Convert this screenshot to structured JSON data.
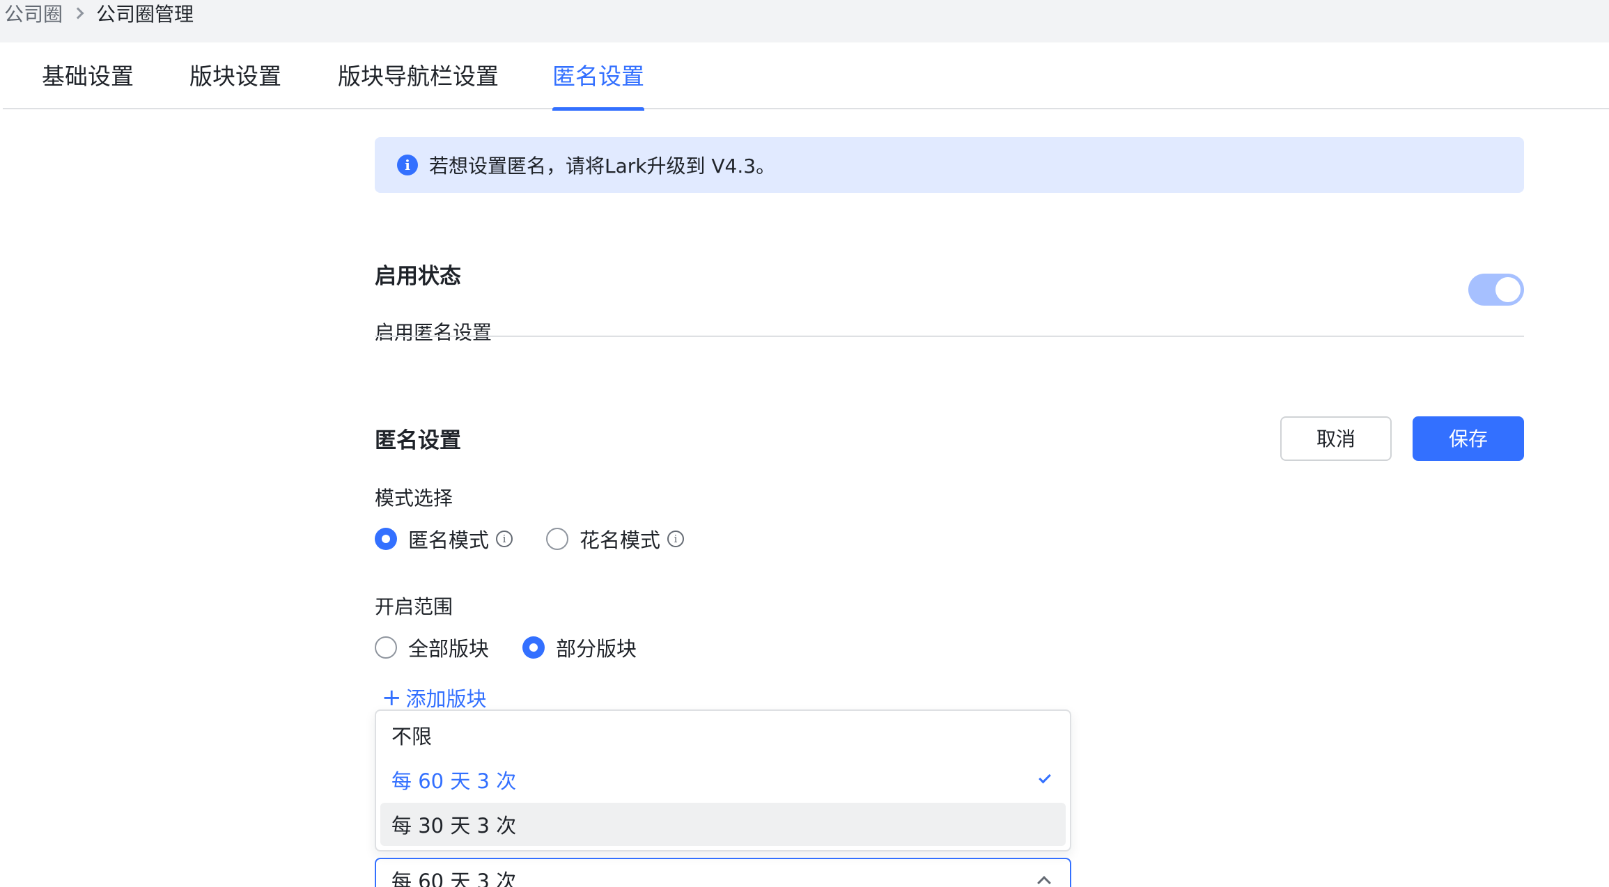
{
  "breadcrumb": {
    "parent": "公司圈",
    "current": "公司圈管理"
  },
  "tabs": [
    {
      "label": "基础设置",
      "active": false
    },
    {
      "label": "版块设置",
      "active": false
    },
    {
      "label": "版块导航栏设置",
      "active": false
    },
    {
      "label": "匿名设置",
      "active": true
    }
  ],
  "notice": {
    "icon": "info-icon",
    "text": "若想设置匿名，请将Lark升级到 V4.3。"
  },
  "enable_section": {
    "title": "启用状态",
    "label": "启用匿名设置",
    "toggle_on": true
  },
  "anonymous_section": {
    "title": "匿名设置",
    "cancel_label": "取消",
    "save_label": "保存",
    "mode": {
      "label": "模式选择",
      "options": [
        {
          "label": "匿名模式",
          "checked": true
        },
        {
          "label": "花名模式",
          "checked": false
        }
      ]
    },
    "scope": {
      "label": "开启范围",
      "options": [
        {
          "label": "全部版块",
          "checked": false
        },
        {
          "label": "部分版块",
          "checked": true
        }
      ]
    },
    "add_board_label": "添加版块",
    "limit_dropdown": {
      "options": [
        "不限",
        "每 60 天 3 次",
        "每 30 天 3 次"
      ],
      "selected": "每 60 天 3 次",
      "hovered": "每 30 天 3 次"
    },
    "limit_select_value": "每 60 天 3 次"
  },
  "colors": {
    "accent": "#3370ff",
    "notice_bg": "#e1eaff",
    "toggle_bg": "#a6c0ff"
  }
}
